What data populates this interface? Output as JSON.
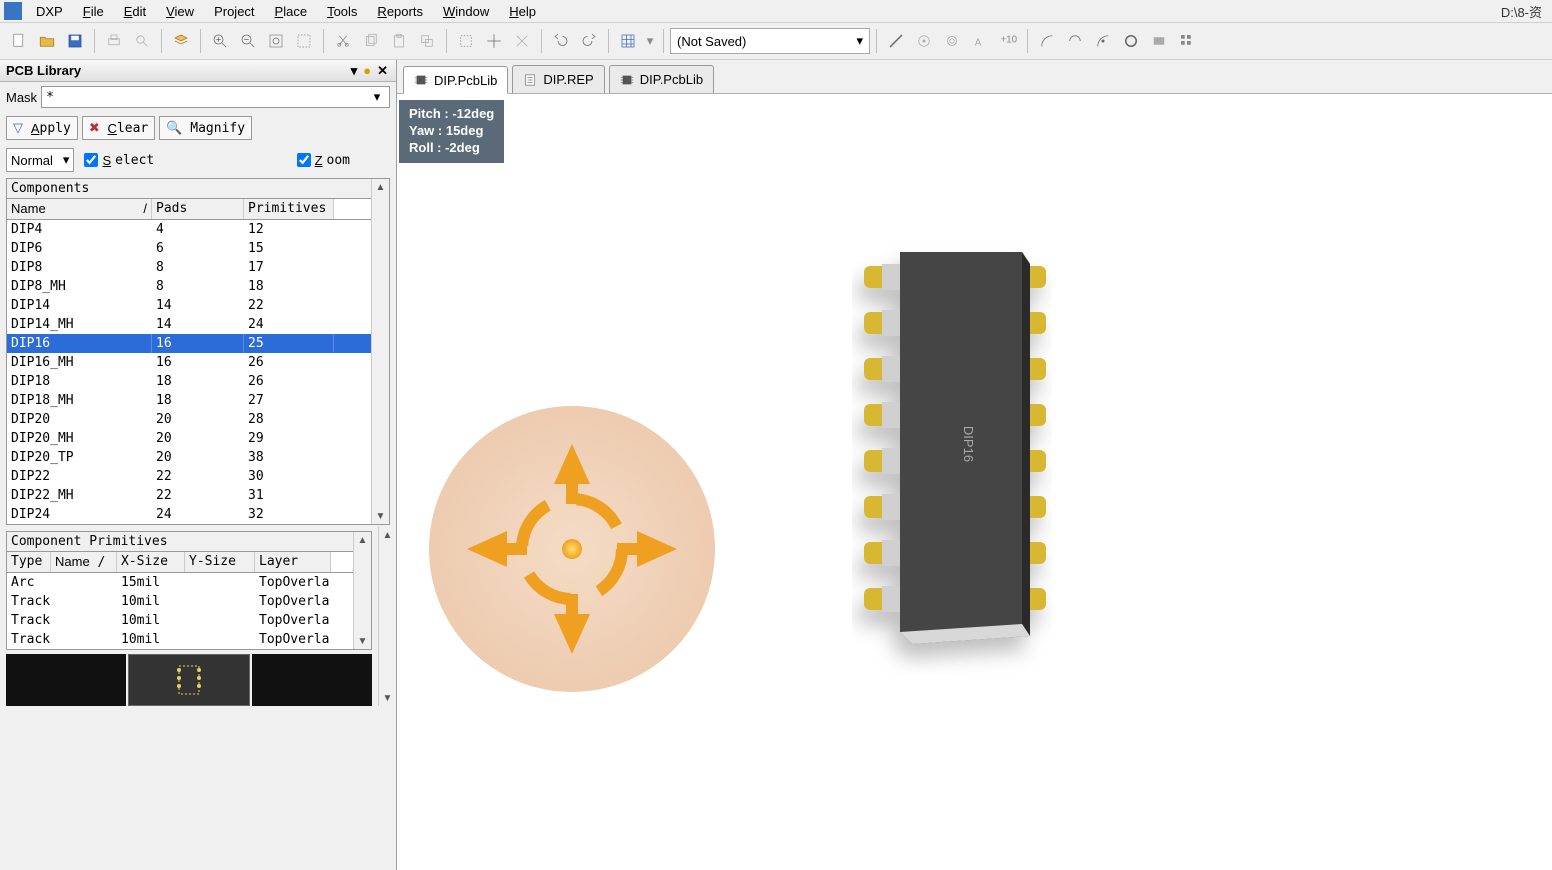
{
  "path_hint": "D:\\8-资",
  "menu": {
    "dxp": "DXP",
    "file": "File",
    "edit": "Edit",
    "view": "View",
    "project": "Project",
    "place": "Place",
    "tools": "Tools",
    "reports": "Reports",
    "window": "Window",
    "help": "Help"
  },
  "toolbar": {
    "combo_value": "(Not Saved)"
  },
  "panel": {
    "title": "PCB Library",
    "mask_label": "Mask",
    "mask_value": "*",
    "apply": "Apply",
    "clear": "Clear",
    "magnify": "Magnify",
    "mode": "Normal",
    "select": "Select",
    "zoom": "Zoom"
  },
  "components": {
    "title": "Components",
    "headers": {
      "name": "Name",
      "pads": "Pads",
      "primitives": "Primitives"
    },
    "rows": [
      {
        "name": "DIP4",
        "pads": "4",
        "prim": "12"
      },
      {
        "name": "DIP6",
        "pads": "6",
        "prim": "15"
      },
      {
        "name": "DIP8",
        "pads": "8",
        "prim": "17"
      },
      {
        "name": "DIP8_MH",
        "pads": "8",
        "prim": "18"
      },
      {
        "name": "DIP14",
        "pads": "14",
        "prim": "22"
      },
      {
        "name": "DIP14_MH",
        "pads": "14",
        "prim": "24"
      },
      {
        "name": "DIP16",
        "pads": "16",
        "prim": "25"
      },
      {
        "name": "DIP16_MH",
        "pads": "16",
        "prim": "26"
      },
      {
        "name": "DIP18",
        "pads": "18",
        "prim": "26"
      },
      {
        "name": "DIP18_MH",
        "pads": "18",
        "prim": "27"
      },
      {
        "name": "DIP20",
        "pads": "20",
        "prim": "28"
      },
      {
        "name": "DIP20_MH",
        "pads": "20",
        "prim": "29"
      },
      {
        "name": "DIP20_TP",
        "pads": "20",
        "prim": "38"
      },
      {
        "name": "DIP22",
        "pads": "22",
        "prim": "30"
      },
      {
        "name": "DIP22_MH",
        "pads": "22",
        "prim": "31"
      },
      {
        "name": "DIP24",
        "pads": "24",
        "prim": "32"
      }
    ],
    "selected": 6
  },
  "primitives": {
    "title": "Component Primitives",
    "headers": {
      "type": "Type",
      "name": "Name",
      "xs": "X-Size",
      "ys": "Y-Size",
      "layer": "Layer"
    },
    "rows": [
      {
        "type": "Arc",
        "name": "",
        "xs": "15mil",
        "ys": "",
        "layer": "TopOverla"
      },
      {
        "type": "Track",
        "name": "",
        "xs": "10mil",
        "ys": "",
        "layer": "TopOverla"
      },
      {
        "type": "Track",
        "name": "",
        "xs": "10mil",
        "ys": "",
        "layer": "TopOverla"
      },
      {
        "type": "Track",
        "name": "",
        "xs": "10mil",
        "ys": "",
        "layer": "TopOverla"
      }
    ]
  },
  "tabs": [
    {
      "label": "DIP.PcbLib",
      "icon": "chip"
    },
    {
      "label": "DIP.REP",
      "icon": "doc"
    },
    {
      "label": "DIP.PcbLib",
      "icon": "chip"
    }
  ],
  "active_tab": 0,
  "orientation": {
    "pitch": "Pitch : -12deg",
    "yaw": "Yaw : 15deg",
    "roll": "Roll : -2deg"
  },
  "chip_label": "DIP16"
}
